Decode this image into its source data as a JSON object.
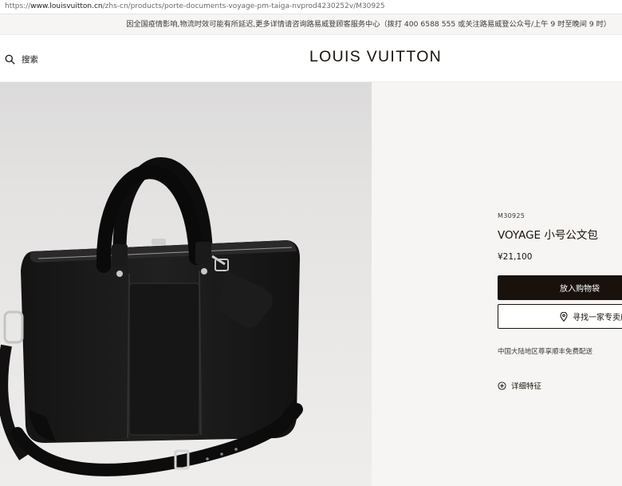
{
  "browser": {
    "url_prefix": "https://",
    "url_host": "www.louisvuitton.cn",
    "url_path": "/zhs-cn/products/porte-documents-voyage-pm-taiga-nvprod4230252v/M30925"
  },
  "notice": {
    "text": "因全国疫情影响,物流时效可能有所延迟,更多详情请咨询路易威登顾客服务中心（拨打 400 6588 555 或关注路易威登公众号/上午 9 时至晚间 9 时）"
  },
  "header": {
    "search_label": "搜索",
    "logo_text": "LOUIS VUITTON",
    "icons": {
      "search": "search-icon"
    }
  },
  "product": {
    "sku": "M30925",
    "name": "VOYAGE 小号公文包",
    "price": "¥21,100",
    "add_to_cart_label": "放入购物袋",
    "find_store_label": "寻找一家专卖店",
    "shipping_note": "中国大陆地区尊享顺丰免费配送",
    "details_label": "详细特征",
    "icons": {
      "store": "location-pin-icon",
      "details": "plus-circle-icon"
    }
  },
  "colors": {
    "brand_dark": "#19110b",
    "panel_bg": "#f6f5f3",
    "notice_bg": "#f6f5f3"
  }
}
